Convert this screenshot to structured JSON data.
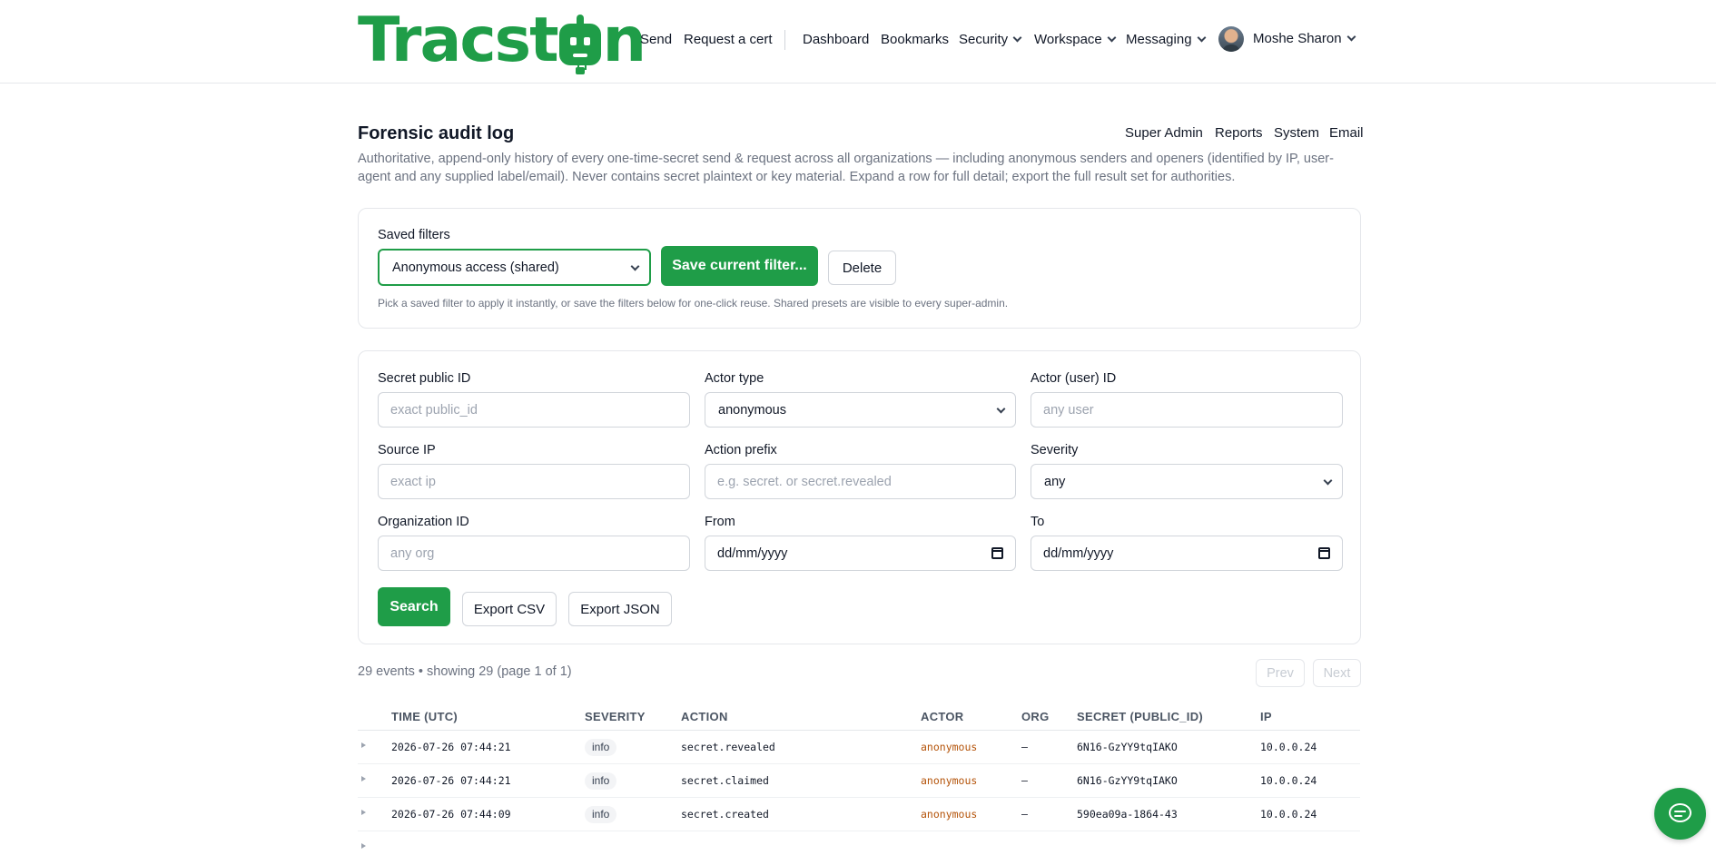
{
  "brand": {
    "name": "Tracston",
    "name_prefix": "Tracst",
    "name_suffix": "n"
  },
  "nav": {
    "send": "Send",
    "request_cert": "Request a cert",
    "dashboard": "Dashboard",
    "bookmarks": "Bookmarks",
    "security": "Security",
    "workspace": "Workspace",
    "messaging": "Messaging",
    "user_name": "Moshe Sharon"
  },
  "page": {
    "title": "Forensic audit log",
    "description": "Authoritative, append-only history of every one-time-secret send & request across all organizations — including anonymous senders and openers (identified by IP, user-agent and any supplied label/email). Never contains secret plaintext or key material. Expand a row for full detail; export the full result set for authorities.",
    "admin_links": [
      "Super Admin",
      "Reports",
      "System",
      "Email"
    ]
  },
  "saved_filters": {
    "label": "Saved filters",
    "selected": "Anonymous access (shared)",
    "save_button": "Save current filter...",
    "delete_button": "Delete",
    "hint": "Pick a saved filter to apply it instantly, or save the filters below for one-click reuse. Shared presets are visible to every super-admin."
  },
  "filters": {
    "secret_public_id": {
      "label": "Secret public ID",
      "placeholder": "exact public_id"
    },
    "actor_type": {
      "label": "Actor type",
      "value": "anonymous"
    },
    "actor_user_id": {
      "label": "Actor (user) ID",
      "placeholder": "any user"
    },
    "source_ip": {
      "label": "Source IP",
      "placeholder": "exact ip"
    },
    "action_prefix": {
      "label": "Action prefix",
      "placeholder": "e.g. secret. or secret.revealed"
    },
    "severity": {
      "label": "Severity",
      "value": "any"
    },
    "organization_id": {
      "label": "Organization ID",
      "placeholder": "any org"
    },
    "from": {
      "label": "From",
      "value": "dd/mm/yyyy"
    },
    "to": {
      "label": "To",
      "value": "dd/mm/yyyy"
    },
    "search_button": "Search",
    "export_csv": "Export CSV",
    "export_json": "Export JSON"
  },
  "results": {
    "summary": "29 events • showing 29 (page 1 of 1)",
    "prev": "Prev",
    "next": "Next",
    "columns": [
      "TIME (UTC)",
      "SEVERITY",
      "ACTION",
      "ACTOR",
      "ORG",
      "SECRET (PUBLIC_ID)",
      "IP"
    ],
    "rows": [
      {
        "time": "2026-07-26 07:44:21",
        "severity": "info",
        "action": "secret.revealed",
        "actor": "anonymous",
        "org": "—",
        "secret": "6N16-GzYY9tqIAKO",
        "ip": "10.0.0.24"
      },
      {
        "time": "2026-07-26 07:44:21",
        "severity": "info",
        "action": "secret.claimed",
        "actor": "anonymous",
        "org": "—",
        "secret": "6N16-GzYY9tqIAKO",
        "ip": "10.0.0.24"
      },
      {
        "time": "2026-07-26 07:44:09",
        "severity": "info",
        "action": "secret.created",
        "actor": "anonymous",
        "org": "—",
        "secret": "590ea09a-1864-43",
        "ip": "10.0.0.24"
      }
    ]
  },
  "colors": {
    "brand_green": "#1f9d48",
    "actor_orange": "#b45309"
  },
  "icons": [
    "chevron-down-icon",
    "robot-logo-icon",
    "calendar-icon",
    "expand-caret-icon",
    "chat-icon"
  ]
}
